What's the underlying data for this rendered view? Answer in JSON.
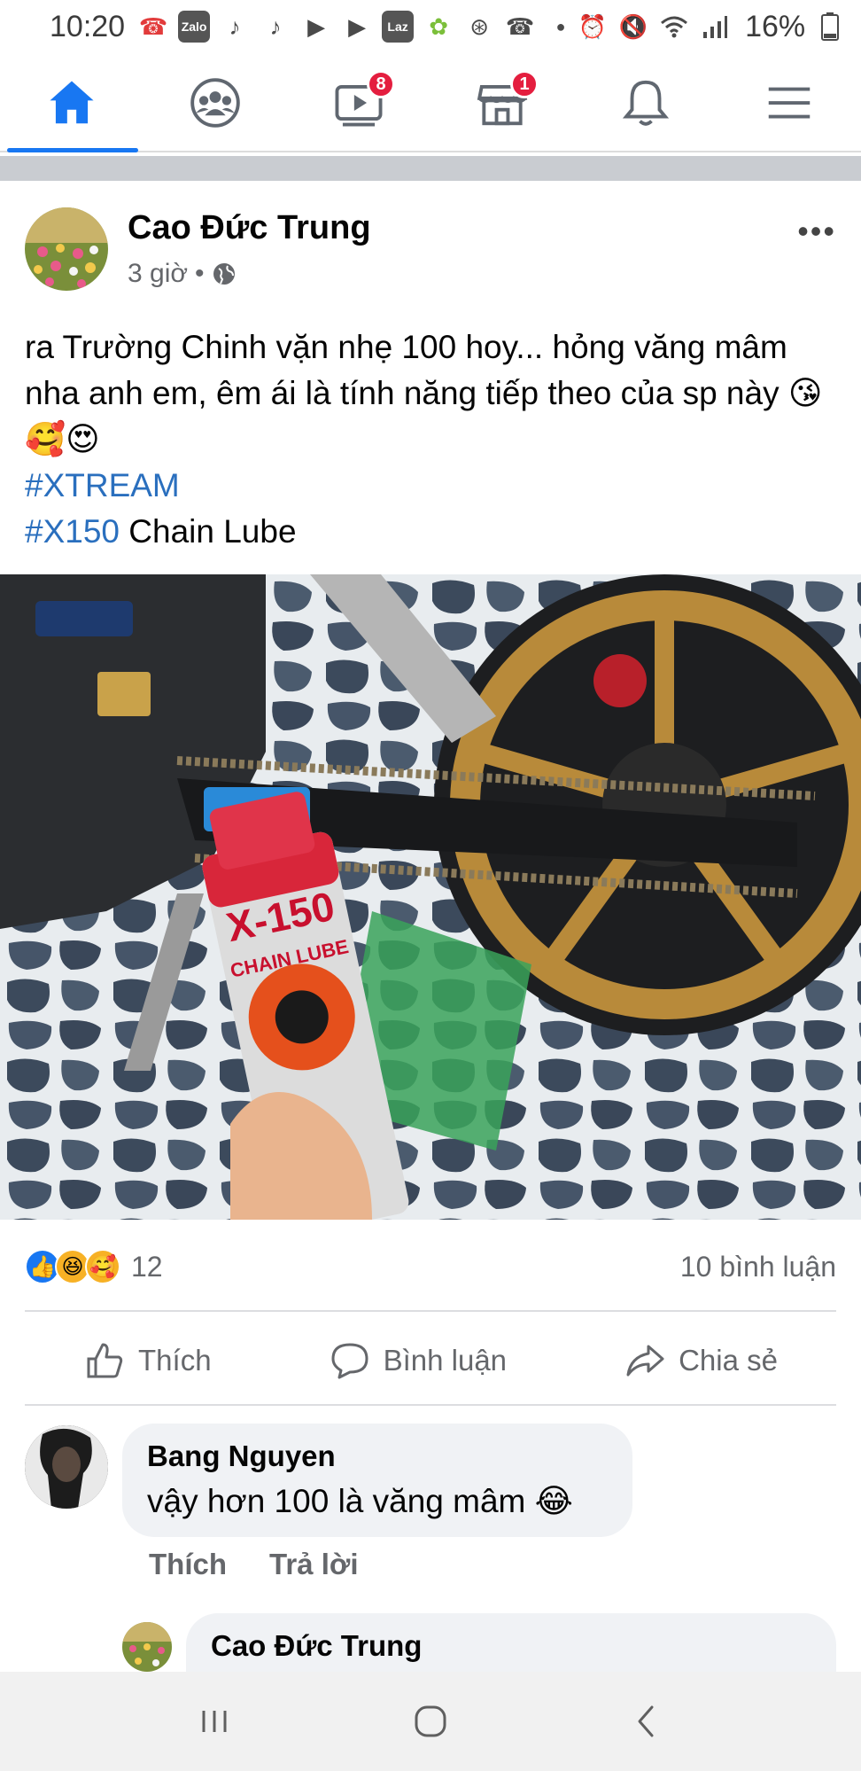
{
  "status_bar": {
    "time": "10:20",
    "battery": "16%",
    "left_icons": [
      "missed-call-icon",
      "zalo-icon",
      "tiktok-icon",
      "tiktok-icon",
      "youtube-icon",
      "youtube-icon",
      "lazada-icon",
      "app-icon",
      "app-icon",
      "missed-call-icon",
      "dot-icon"
    ],
    "right_icons": [
      "alarm-icon",
      "mute-icon",
      "wifi-icon",
      "signal-icon",
      "battery-icon"
    ],
    "zalo_label": "Zalo",
    "laz_label": "Laz"
  },
  "nav": {
    "items": [
      {
        "name": "home",
        "icon": "home-icon",
        "active": true
      },
      {
        "name": "groups",
        "icon": "groups-icon"
      },
      {
        "name": "watch",
        "icon": "video-icon",
        "badge": "8"
      },
      {
        "name": "marketplace",
        "icon": "marketplace-icon",
        "badge": "1"
      },
      {
        "name": "notifications",
        "icon": "bell-icon"
      },
      {
        "name": "menu",
        "icon": "menu-icon"
      }
    ],
    "active_color": "#1877f2"
  },
  "post": {
    "author": "Cao Đức Trung",
    "time": "3 giờ",
    "separator": "•",
    "audience_icon": "globe-icon",
    "more": "•••",
    "text_line1": "ra Trường Chinh vặn nhẹ 100 hoy... hỏng văng mâm nha anh em, êm ái là tính năng tiếp theo của sp này",
    "emojis": "😘🥰😍",
    "hashtag1": "#XTREAM",
    "hashtag2": "#X150",
    "line3_rest": " Chain Lube",
    "hashtag_color": "#2a6fbe",
    "photo": {
      "can_label_brand": "X-150",
      "can_label_product": "CHAIN LUBE"
    },
    "reactions": {
      "icons": [
        "like-icon",
        "haha-icon",
        "care-icon"
      ],
      "count": "12",
      "comments": "10 bình luận"
    },
    "actions": {
      "like": "Thích",
      "comment": "Bình luận",
      "share": "Chia sẻ"
    }
  },
  "comments": [
    {
      "author": "Bang Nguyen",
      "text": "vậy hơn 100 là văng mâm",
      "emoji": "😂",
      "like": "Thích",
      "reply": "Trả lời"
    }
  ],
  "reply": {
    "author": "Cao Đức Trung"
  },
  "system_nav": {
    "icons": [
      "recents-icon",
      "home-circle-icon",
      "back-icon"
    ]
  }
}
